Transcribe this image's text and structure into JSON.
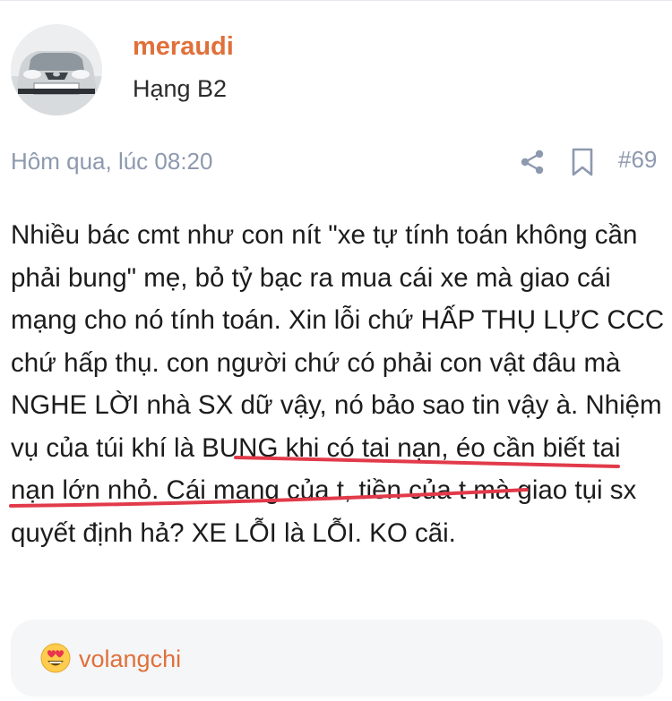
{
  "post": {
    "author": "meraudi",
    "rank": "Hạng B2",
    "timestamp": "Hôm qua, lúc 08:20",
    "number": "#69",
    "body": "Nhiều bác cmt như con nít \"xe tự tính toán không cần phải bung\" mẹ, bỏ tỷ bạc ra mua cái xe mà giao cái mạng cho nó tính toán. Xin lỗi chứ HẤP THỤ LỰC CCC chứ hấp thụ. con người chứ có phải con vật đâu mà NGHE LỜI nhà SX dữ vậy, nó bảo sao tin vậy à. Nhiệm vụ của túi khí là BUNG khi có tai nạn, éo cần biết tai nạn lớn nhỏ. Cái mạng của t, tiền của t mà giao tụi sx quyết định hả? XE LỖI là LỖI. KO cãi."
  },
  "icons": {
    "share": "share-icon",
    "bookmark": "bookmark-icon",
    "reaction": "heart-eyes-emoji-icon"
  },
  "reactions": {
    "user": "volangchi"
  },
  "colors": {
    "username": "#e0703a",
    "meta": "#8d99ae",
    "underline": "#e23a4a",
    "reaction_bg": "#f5f6f8"
  }
}
